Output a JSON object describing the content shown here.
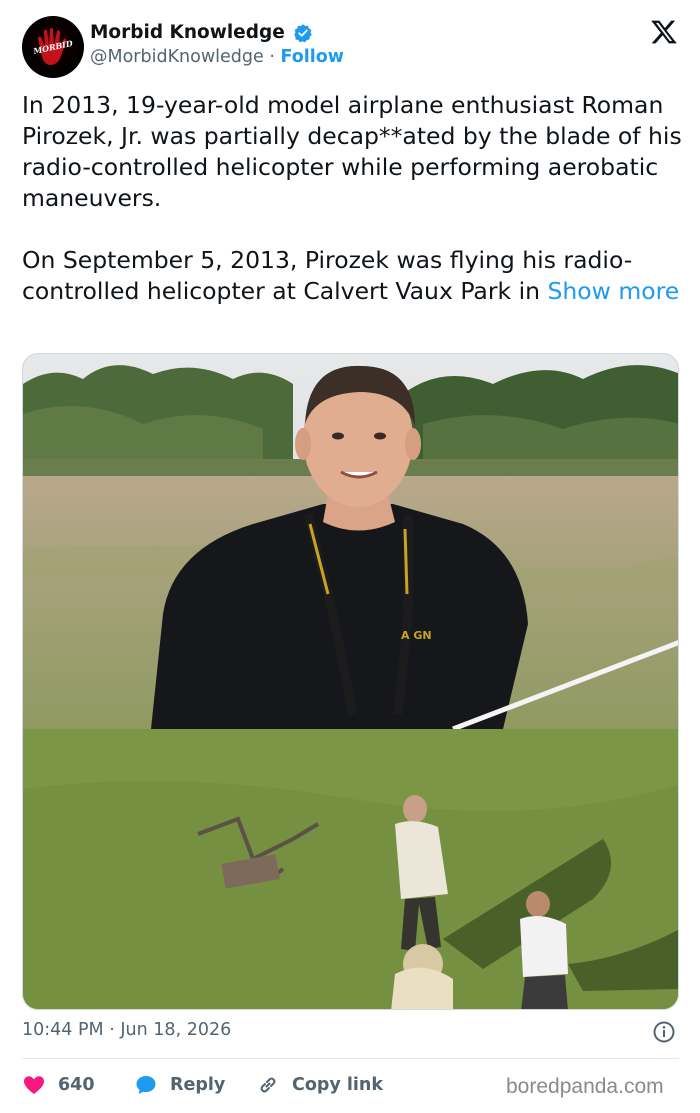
{
  "author": {
    "display_name": "Morbid Knowledge",
    "handle": "@MorbidKnowledge",
    "separator": "·",
    "follow_label": "Follow",
    "avatar_text": "MORBID",
    "verified": true
  },
  "tweet": {
    "paragraph_1": "In 2013, 19-year-old model airplane enthusiast Roman Pirozek, Jr. was partially decap**ated by the blade of his radio-controlled helicopter while performing aerobatic maneuvers.",
    "paragraph_2": "On September 5, 2013, Pirozek was flying his radio-controlled helicopter at Calvert Vaux Park in",
    "show_more": "Show more"
  },
  "meta": {
    "time": "10:44 PM",
    "separator": "·",
    "date": "Jun 18, 2026"
  },
  "actions": {
    "like_count": "640",
    "reply_label": "Reply",
    "copy_link_label": "Copy link"
  },
  "watermark": "boredpanda.com",
  "colors": {
    "accent": "#1d9bf0",
    "like": "#f91880",
    "secondary_text": "#536471"
  }
}
